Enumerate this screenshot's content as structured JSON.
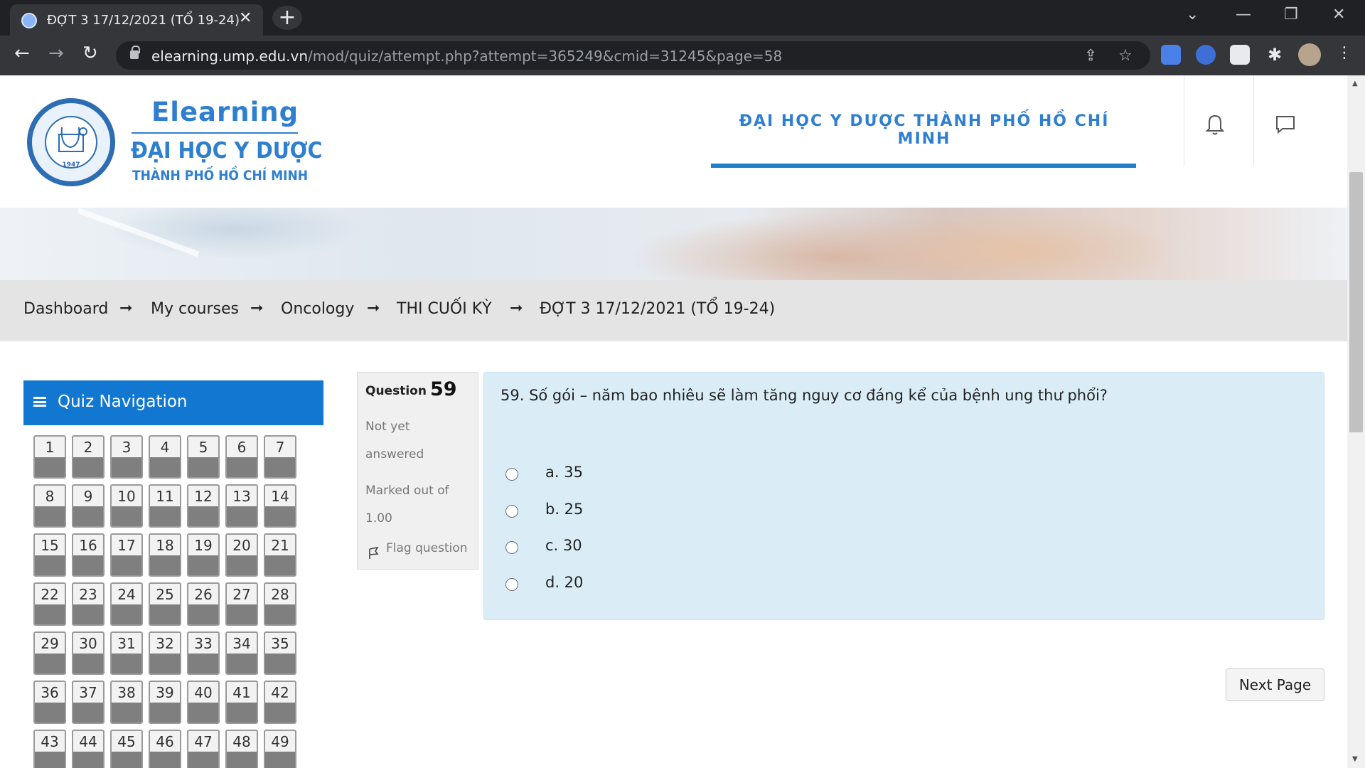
{
  "browser": {
    "tab_title": "ĐỢT 3 17/12/2021 (TỔ 19-24)",
    "tab_close": "✕",
    "new_tab": "+",
    "url_host": "elearning.ump.edu.vn",
    "url_path": "/mod/quiz/attempt.php?attempt=365249&cmid=31245&page=58"
  },
  "header": {
    "logo_year": "1947",
    "brand_title": "Elearning",
    "brand_sub1": "ĐẠI HỌC Y DƯỢC",
    "brand_sub2": "THÀNH PHỐ HỒ CHÍ MINH",
    "university_name": "ĐẠI HỌC Y DƯỢC THÀNH PHỐ HỒ CHÍ MINH"
  },
  "breadcrumb": {
    "items": [
      "Dashboard",
      "My courses",
      "Oncology",
      "THI CUỐI KỲ",
      "ĐỢT 3 17/12/2021 (TỔ 19-24)"
    ],
    "separator": "➞"
  },
  "quiz_nav": {
    "title": "Quiz Navigation",
    "questions": [
      "1",
      "2",
      "3",
      "4",
      "5",
      "6",
      "7",
      "8",
      "9",
      "10",
      "11",
      "12",
      "13",
      "14",
      "15",
      "16",
      "17",
      "18",
      "19",
      "20",
      "21",
      "22",
      "23",
      "24",
      "25",
      "26",
      "27",
      "28",
      "29",
      "30",
      "31",
      "32",
      "33",
      "34",
      "35",
      "36",
      "37",
      "38",
      "39",
      "40",
      "41",
      "42",
      "43",
      "44",
      "45",
      "46",
      "47",
      "48",
      "49"
    ]
  },
  "question": {
    "label": "Question",
    "number": "59",
    "state": "Not yet answered",
    "grade": "Marked out of 1.00",
    "flag": "Flag question",
    "text": "59. Số gói – năm bao nhiêu sẽ làm tăng nguy cơ đáng kể của bệnh ung thư phổi?",
    "answers": [
      "a. 35",
      "b. 25",
      "c. 30",
      "d. 20"
    ]
  },
  "next_button": "Next Page",
  "colors": {
    "primary": "#1177d1",
    "question_bg": "#daedf7",
    "breadcrumb_bg": "#e4e4e4"
  }
}
